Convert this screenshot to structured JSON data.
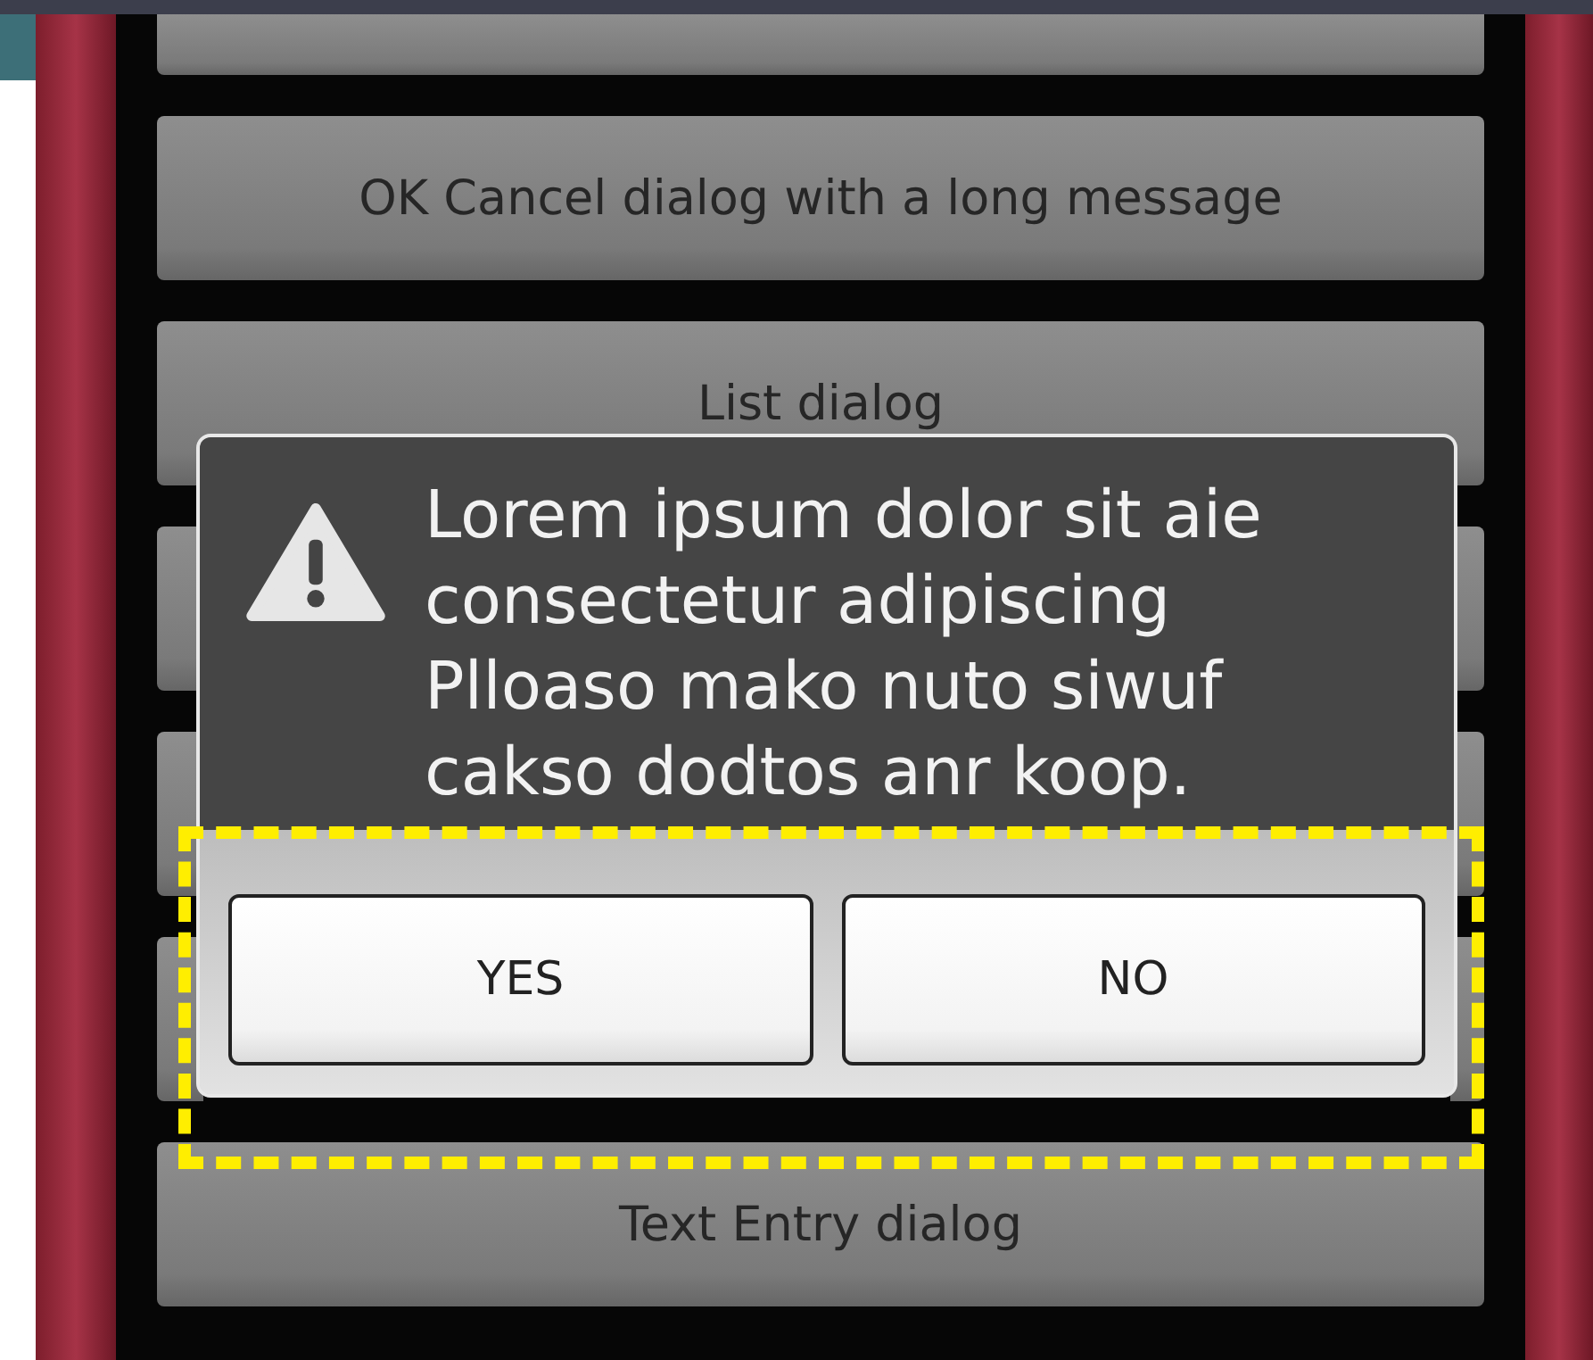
{
  "menu_buttons": [
    {
      "label": "OK Cancel dialog with a long message"
    },
    {
      "label": "List dialog"
    },
    {
      "label": "Text Entry dialog"
    }
  ],
  "dialog": {
    "message": "Lorem ipsum dolor sit aie\nconsectetur adipiscing\nPlloaso mako nuto siwuf\ncakso dodtos anr koop.",
    "buttons": [
      {
        "label": "YES"
      },
      {
        "label": "NO"
      }
    ]
  }
}
